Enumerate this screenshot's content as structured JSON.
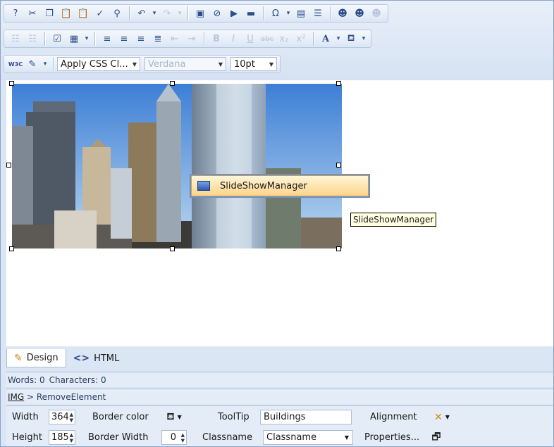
{
  "toolbar": {
    "row1": [
      "help-icon",
      "cut-icon",
      "copy-icon",
      "paste-icon",
      "paste-special-icon",
      "spellcheck-icon",
      "find-icon",
      "undo-icon",
      "redo-icon",
      "image-icon",
      "flash-icon",
      "media-icon",
      "insert-box-icon",
      "symbol-icon",
      "insert-table-icon",
      "paragraph-icon",
      "user-icon",
      "users-icon",
      "users-disabled-icon"
    ],
    "row2": [
      "ordered-list-icon",
      "unordered-list-icon",
      "select-all-icon",
      "table-icon",
      "align-left-icon",
      "align-center-icon",
      "align-right-icon",
      "justify-icon",
      "outdent-icon",
      "indent-icon",
      "bold-icon",
      "italic-icon",
      "underline-icon",
      "strikethrough-icon",
      "subscript-icon",
      "superscript-icon",
      "font-color-icon",
      "highlight-icon"
    ],
    "css_class_label": "Apply CSS Cl...",
    "font_name": "Verdana",
    "font_size": "10pt"
  },
  "editor": {
    "context_item": "SlideShowManager",
    "tooltip": "SlideShowManager"
  },
  "modes": {
    "design": "Design",
    "html": "HTML"
  },
  "status": {
    "words": "Words: 0",
    "characters": "Characters: 0",
    "path_tag": "IMG",
    "path_rest": " > RemoveElement"
  },
  "props": {
    "width_label": "Width",
    "width_value": "364",
    "height_label": "Height",
    "height_value": "185",
    "border_color_label": "Border color",
    "border_width_label": "Border Width",
    "border_width_value": "0",
    "tooltip_label": "ToolTip",
    "tooltip_value": "Buildings",
    "classname_label": "Classname",
    "classname_value": "Classname",
    "alignment_label": "Alignment",
    "properties_label": "Properties..."
  },
  "colors": {
    "accent": "#2c4c8a",
    "toolbar_bg": "#dbe6f4",
    "selection": "#fbd48a"
  }
}
